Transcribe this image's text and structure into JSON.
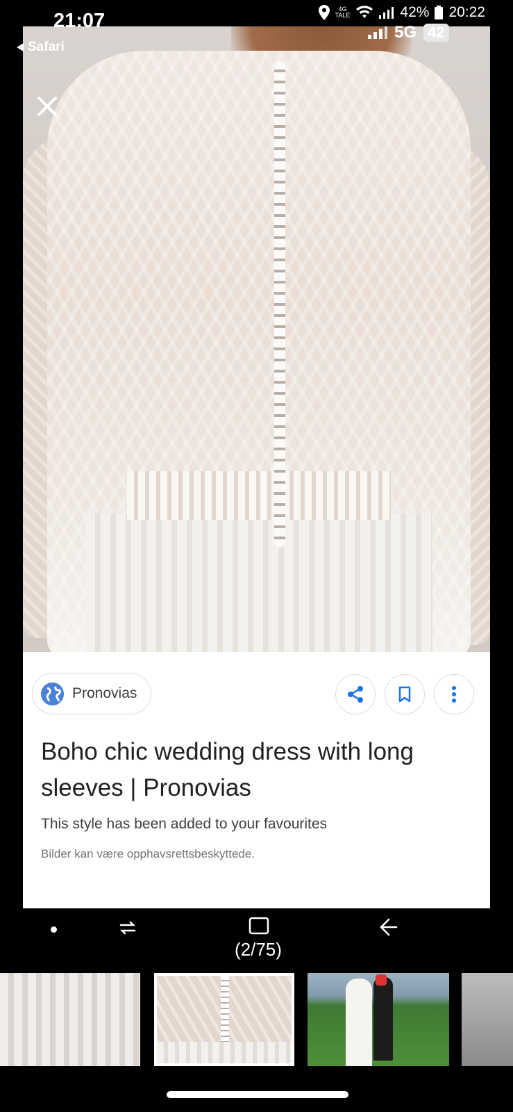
{
  "outer_status": {
    "network_tag": "4G",
    "network_sub": "TALE",
    "battery": "42%",
    "time": "20:22"
  },
  "inner_status": {
    "time": "21:07",
    "back_app": "Safari",
    "network": "5G",
    "battery": "42"
  },
  "viewer": {
    "close_icon": "close-icon"
  },
  "card": {
    "source": "Pronovias",
    "title": "Boho chic wedding dress with long sleeves | Pronovias",
    "subtitle": "This style has been added to your favourites",
    "copyright": "Bilder kan være opphavsrettsbeskyttede."
  },
  "nav": {
    "counter": "(2/75)"
  },
  "colors": {
    "accent_blue": "#1a73e8",
    "background": "#000000",
    "card": "#ffffff"
  }
}
